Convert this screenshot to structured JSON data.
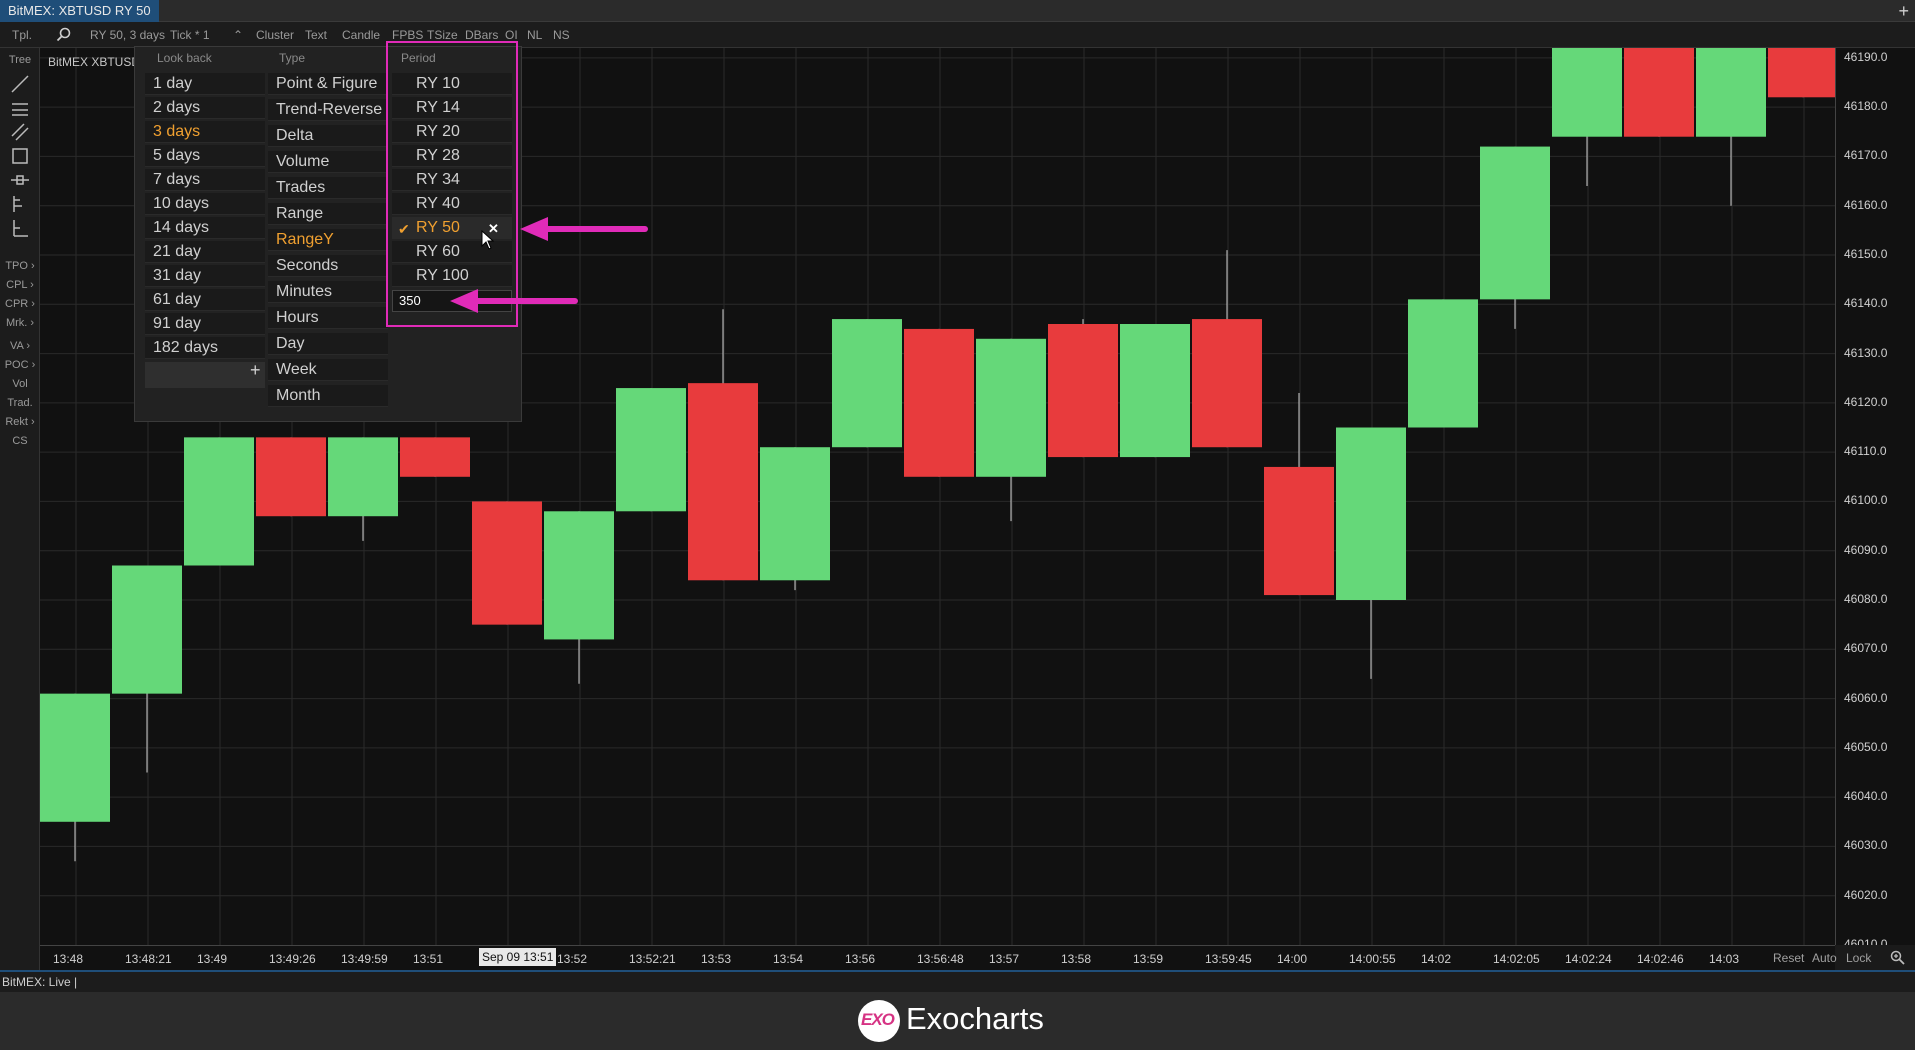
{
  "window": {
    "tab_title": "BitMEX: XBTUSD RY 50",
    "new_tab": "+"
  },
  "toolbar": {
    "tpl": "Tpl.",
    "search_icon": "search-icon",
    "period_selector": "RY 50, 3 days",
    "tick_selector": "Tick * 1",
    "items": [
      "Cluster",
      "Text",
      "Candle",
      "FPBS",
      "TSize",
      "DBars",
      "OI",
      "NL",
      "NS"
    ]
  },
  "left_tools": {
    "tree": "Tree",
    "icons": [
      "line-tool-icon",
      "horizontal-lines-icon",
      "parallel-channel-icon",
      "rectangle-icon",
      "horizontal-ray-icon",
      "fib-icon",
      "measure-icon"
    ],
    "menu": [
      "TPO",
      "CPL",
      "CPR",
      "Mrk.",
      "VA",
      "POC",
      "Vol",
      "Trad.",
      "Rekt",
      "CS"
    ]
  },
  "chart": {
    "symbol_label": "BitMEX XBTUSD",
    "colors": {
      "up": "#65d879",
      "down": "#e83b3d",
      "background": "#111111",
      "grid": "#2a2a2a",
      "wick": "#d0d0d0"
    },
    "price_labels": [
      "46190.0",
      "46180.0",
      "46170.0",
      "46160.0",
      "46150.0",
      "46140.0",
      "46130.0",
      "46120.0",
      "46110.0",
      "46100.0",
      "46090.0",
      "46080.0",
      "46070.0",
      "46060.0",
      "46050.0",
      "46040.0",
      "46030.0",
      "46020.0",
      "46010.0"
    ],
    "time_labels": [
      "13:48",
      "13:48:21",
      "13:49",
      "13:49:26",
      "13:49:59",
      "13:51",
      "Sep 09 13:51",
      "13:52",
      "13:52:21",
      "13:53",
      "13:54",
      "13:56",
      "13:56:48",
      "13:57",
      "13:58",
      "13:59",
      "13:59:45",
      "14:00",
      "14:00:55",
      "14:02",
      "14:02:05",
      "14:02:24",
      "14:02:46",
      "14:03"
    ],
    "axis_controls": [
      "Reset",
      "Auto",
      "Lock"
    ],
    "zoom_icon": "zoom-icon"
  },
  "chart_data": {
    "type": "candlestick",
    "ylim": [
      46010,
      46192
    ],
    "candles": [
      {
        "time": "13:48",
        "open": 46035,
        "close": 46061,
        "low": 46027,
        "high": 46061
      },
      {
        "time": "13:48:21",
        "open": 46061,
        "close": 46087,
        "low": 46045,
        "high": 46087
      },
      {
        "time": "13:49",
        "open": 46087,
        "close": 46113,
        "low": 46087,
        "high": 46113
      },
      {
        "time": "13:49:26",
        "open": 46113,
        "close": 46097,
        "low": 46097,
        "high": 46113
      },
      {
        "time": "13:49:59",
        "open": 46097,
        "close": 46113,
        "low": 46092,
        "high": 46113
      },
      {
        "time": "13:51",
        "open": 46113,
        "close": 46105,
        "low": 46105,
        "high": 46113
      },
      {
        "time": "Sep 09 13:51",
        "open": 46100,
        "close": 46075,
        "low": 46075,
        "high": 46100
      },
      {
        "time": "13:52",
        "open": 46072,
        "close": 46098,
        "low": 46063,
        "high": 46098
      },
      {
        "time": "13:52:21",
        "open": 46098,
        "close": 46123,
        "low": 46098,
        "high": 46123
      },
      {
        "time": "13:53",
        "open": 46124,
        "close": 46084,
        "low": 46084,
        "high": 46139
      },
      {
        "time": "13:54",
        "open": 46084,
        "close": 46111,
        "low": 46082,
        "high": 46111
      },
      {
        "time": "13:56",
        "open": 46111,
        "close": 46137,
        "low": 46111,
        "high": 46137
      },
      {
        "time": "13:56:48",
        "open": 46135,
        "close": 46105,
        "low": 46105,
        "high": 46135
      },
      {
        "time": "13:57",
        "open": 46105,
        "close": 46133,
        "low": 46096,
        "high": 46133
      },
      {
        "time": "13:58",
        "open": 46136,
        "close": 46109,
        "low": 46109,
        "high": 46137
      },
      {
        "time": "13:59",
        "open": 46109,
        "close": 46136,
        "low": 46109,
        "high": 46136
      },
      {
        "time": "13:59:45",
        "open": 46137,
        "close": 46111,
        "low": 46111,
        "high": 46151
      },
      {
        "time": "14:00",
        "open": 46107,
        "close": 46081,
        "low": 46081,
        "high": 46122
      },
      {
        "time": "14:00:55",
        "open": 46080,
        "close": 46115,
        "low": 46064,
        "high": 46115
      },
      {
        "time": "14:02",
        "open": 46115,
        "close": 46141,
        "low": 46115,
        "high": 46141
      },
      {
        "time": "14:02:05",
        "open": 46141,
        "close": 46172,
        "low": 46135,
        "high": 46172
      },
      {
        "time": "14:02:24",
        "open": 46174,
        "close": 46199,
        "low": 46164,
        "high": 46199
      },
      {
        "time": "14:02:46",
        "open": 46199,
        "close": 46174,
        "low": 46174,
        "high": 46199
      },
      {
        "time": "14:03",
        "open": 46174,
        "close": 46199,
        "low": 46160,
        "high": 46199
      },
      {
        "time": "",
        "open": 46199,
        "close": 46182,
        "low": 46182,
        "high": 46199
      },
      {
        "time": "",
        "open": 46180,
        "close": 46199,
        "low": 46180,
        "high": 46199
      }
    ]
  },
  "dropdown": {
    "lookback_header": "Look back",
    "type_header": "Type",
    "period_header": "Period",
    "lookback": [
      "1 day",
      "2 days",
      "3 days",
      "5 days",
      "7 days",
      "10 days",
      "14 days",
      "21 day",
      "31 day",
      "61 day",
      "91 day",
      "182 days"
    ],
    "lookback_selected": 2,
    "types": [
      "Point & Figure",
      "Trend-Reverse",
      "Delta",
      "Volume",
      "Trades",
      "Range",
      "RangeY",
      "Seconds",
      "Minutes",
      "Hours",
      "Day",
      "Week",
      "Month"
    ],
    "type_selected": 6,
    "periods": [
      "RY 10",
      "RY 14",
      "RY 20",
      "RY 28",
      "RY 34",
      "RY 40",
      "RY 50",
      "RY 60",
      "RY 100"
    ],
    "period_selected": 6,
    "custom_input_value": "350",
    "add_custom": "+",
    "remove_icon": "close-icon",
    "check_icon": "check-icon",
    "annotation_color": "#e02bb8"
  },
  "status": {
    "text": "BitMEX: Live |"
  },
  "footer": {
    "logo_text": "EXO",
    "brand": "Exocharts"
  }
}
